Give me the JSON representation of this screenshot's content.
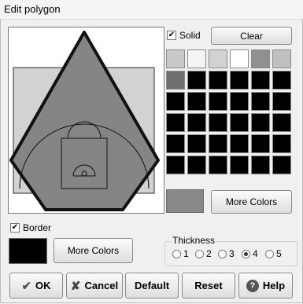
{
  "window": {
    "title": "Edit polygon"
  },
  "fill": {
    "solid_label": "Solid",
    "solid_checked": true,
    "clear_label": "Clear",
    "more_colors_label": "More Colors",
    "selected_color": "#888888",
    "palette": [
      "#c8c8c8",
      "#f4f4f4",
      "#d2d2d2",
      "#ffffff",
      "#909090",
      "#c0c0c0",
      "#707070",
      "#000000",
      "#000000",
      "#000000",
      "#000000",
      "#000000",
      "#000000",
      "#000000",
      "#000000",
      "#000000",
      "#000000",
      "#000000",
      "#000000",
      "#000000",
      "#000000",
      "#000000",
      "#000000",
      "#000000",
      "#000000",
      "#000000",
      "#000000",
      "#000000",
      "#000000",
      "#000000",
      "#000000",
      "#000000",
      "#000000",
      "#000000",
      "#000000",
      "#000000"
    ]
  },
  "border": {
    "label": "Border",
    "checked": true,
    "color": "#000000",
    "more_colors_label": "More Colors"
  },
  "thickness": {
    "label": "Thickness",
    "options": [
      "1",
      "2",
      "3",
      "4",
      "5"
    ],
    "selected": "4"
  },
  "buttons": {
    "ok": "OK",
    "cancel": "Cancel",
    "default": "Default",
    "reset": "Reset",
    "help": "Help"
  },
  "icons": {
    "ok": "check-icon",
    "cancel": "x-icon",
    "help": "question-icon"
  }
}
